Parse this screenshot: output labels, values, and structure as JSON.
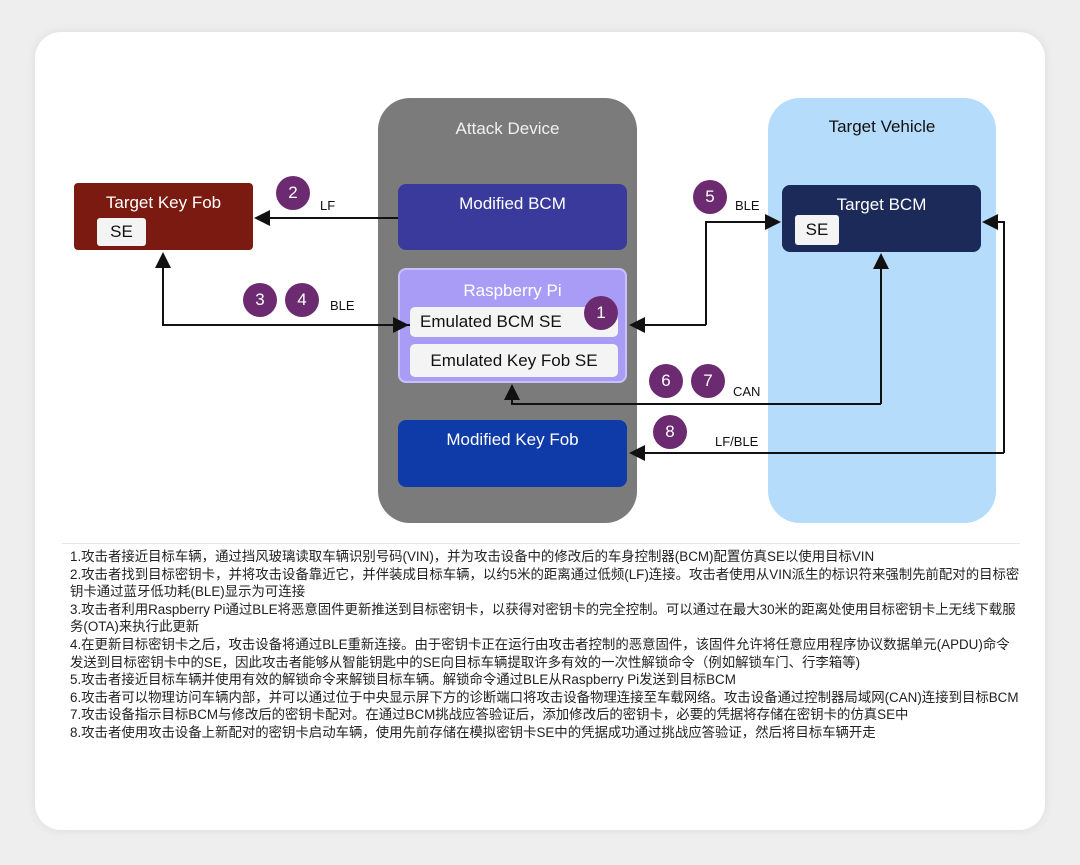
{
  "attack_device": {
    "title": "Attack Device",
    "modified_bcm": "Modified BCM",
    "raspberry_pi": "Raspberry Pi",
    "emulated_bcm_se": "Emulated BCM SE",
    "emulated_key_fob_se": "Emulated Key Fob SE",
    "modified_key_fob": "Modified Key Fob"
  },
  "target_vehicle": {
    "title": "Target Vehicle",
    "target_bcm": "Target BCM",
    "se": "SE"
  },
  "target_key_fob": {
    "title": "Target Key Fob",
    "se": "SE"
  },
  "steps": [
    "1",
    "2",
    "3",
    "4",
    "5",
    "6",
    "7",
    "8"
  ],
  "links": {
    "lf": "LF",
    "ble_fob": "BLE",
    "ble_bcm": "BLE",
    "can": "CAN",
    "lf_ble": "LF/BLE"
  },
  "colors": {
    "attack_device": "#7b7b7b",
    "target_vehicle": "#b5dcfb",
    "key_fob": "#7a1a10",
    "modified_bcm": "#3a3a9c",
    "raspberry_pi": "#a99cf6",
    "modified_key_fob": "#0f3ba8",
    "target_bcm": "#1b2a58",
    "step_badge": "#6c2a70"
  },
  "notes": [
    "1.攻击者接近目标车辆，通过挡风玻璃读取车辆识别号码(VIN)，并为攻击设备中的修改后的车身控制器(BCM)配置仿真SE以使用目标VIN",
    "2.攻击者找到目标密钥卡，并将攻击设备靠近它，并伴装成目标车辆，以约5米的距离通过低频(LF)连接。攻击者使用从VIN派生的标识符来强制先前配对的目标密钥卡通过蓝牙低功耗(BLE)显示为可连接",
    "3.攻击者利用Raspberry Pi通过BLE将恶意固件更新推送到目标密钥卡，以获得对密钥卡的完全控制。可以通过在最大30米的距离处使用目标密钥卡上无线下载服务(OTA)来执行此更新",
    "4.在更新目标密钥卡之后，攻击设备将通过BLE重新连接。由于密钥卡正在运行由攻击者控制的恶意固件，该固件允许将任意应用程序协议数据单元(APDU)命令发送到目标密钥卡中的SE，因此攻击者能够从智能钥匙中的SE向目标车辆提取许多有效的一次性解锁命令（例如解锁车门、行李箱等)",
    "5.攻击者接近目标车辆并使用有效的解锁命令来解锁目标车辆。解锁命令通过BLE从Raspberry Pi发送到目标BCM",
    "6.攻击者可以物理访问车辆内部，并可以通过位于中央显示屏下方的诊断端口将攻击设备物理连接至车载网络。攻击设备通过控制器局域网(CAN)连接到目标BCM",
    "7.攻击设备指示目标BCM与修改后的密钥卡配对。在通过BCM挑战应答验证后，添加修改后的密钥卡，必要的凭据将存储在密钥卡的仿真SE中",
    "8.攻击者使用攻击设备上新配对的密钥卡启动车辆，使用先前存储在模拟密钥卡SE中的凭据成功通过挑战应答验证，然后将目标车辆开走"
  ]
}
